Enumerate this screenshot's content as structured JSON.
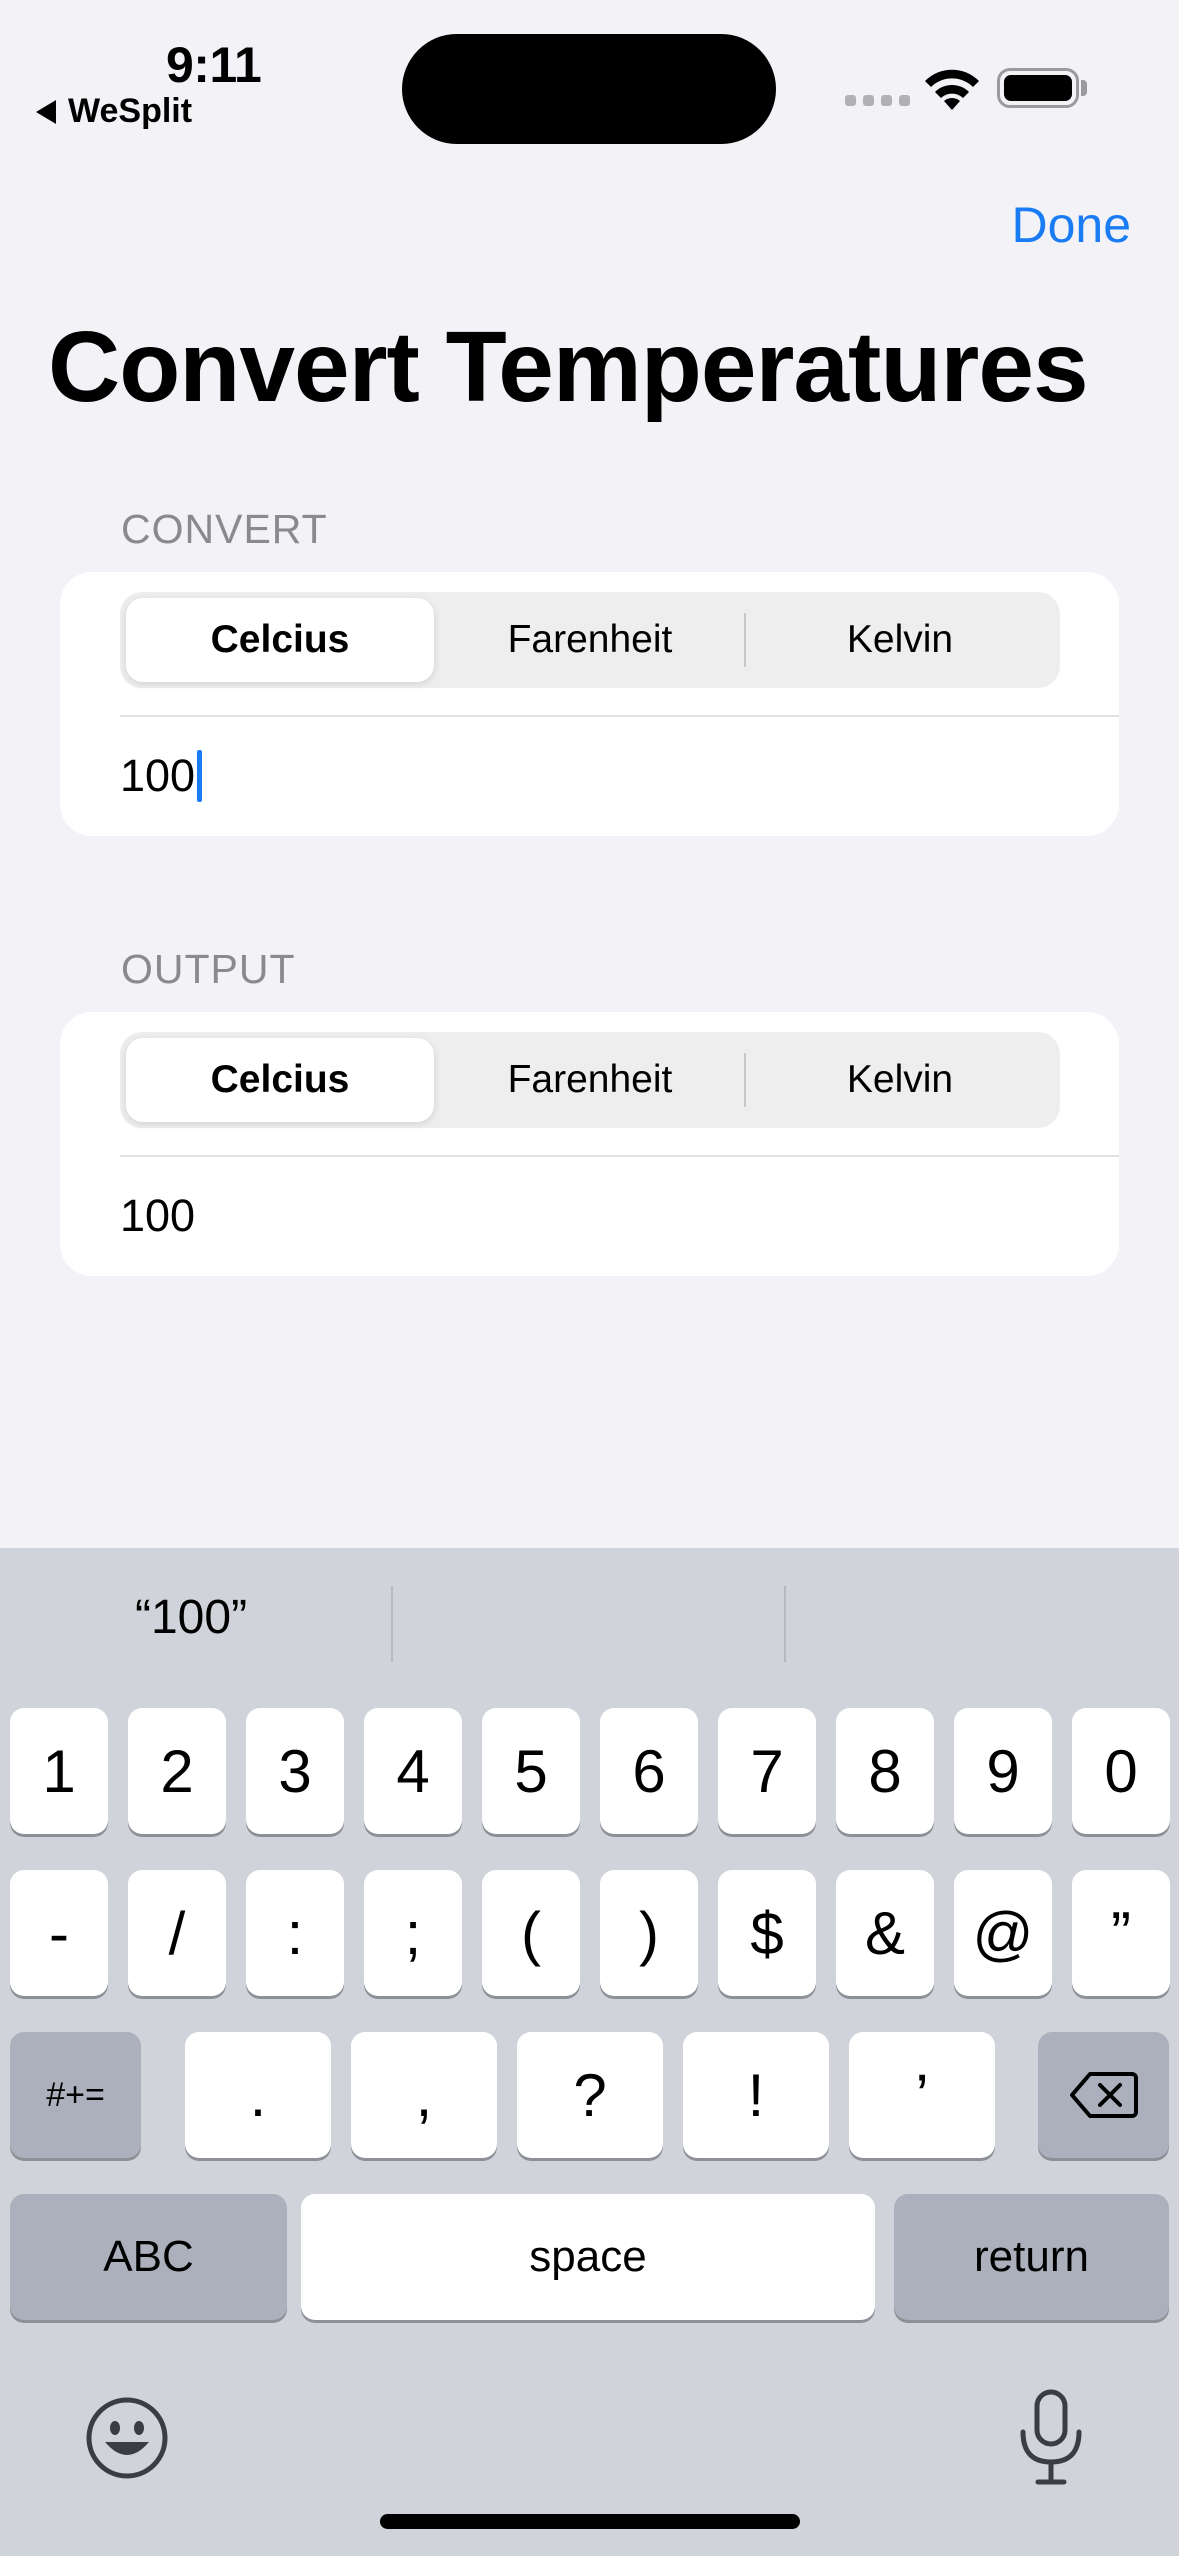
{
  "status_bar": {
    "time": "9:11",
    "back_app": "WeSplit"
  },
  "nav": {
    "done_label": "Done",
    "title": "Convert Temperatures"
  },
  "convert_section": {
    "header": "CONVERT",
    "units": [
      "Celcius",
      "Farenheit",
      "Kelvin"
    ],
    "selected_unit": "Celcius",
    "value": "100"
  },
  "output_section": {
    "header": "OUTPUT",
    "units": [
      "Celcius",
      "Farenheit",
      "Kelvin"
    ],
    "selected_unit": "Celcius",
    "value": "100"
  },
  "keyboard": {
    "suggestions": [
      "“100”",
      "",
      ""
    ],
    "row1": [
      "1",
      "2",
      "3",
      "4",
      "5",
      "6",
      "7",
      "8",
      "9",
      "0"
    ],
    "row2": [
      "-",
      "/",
      ":",
      ";",
      "(",
      ")",
      "$",
      "&",
      "@",
      "”"
    ],
    "row3": [
      "#+=",
      ".",
      ",",
      "?",
      "!",
      "’"
    ],
    "abc_label": "ABC",
    "space_label": "space",
    "return_label": "return"
  },
  "colors": {
    "accent": "#1a7cf5",
    "background": "#f2f2f7",
    "keyboard": "#d1d3da"
  }
}
